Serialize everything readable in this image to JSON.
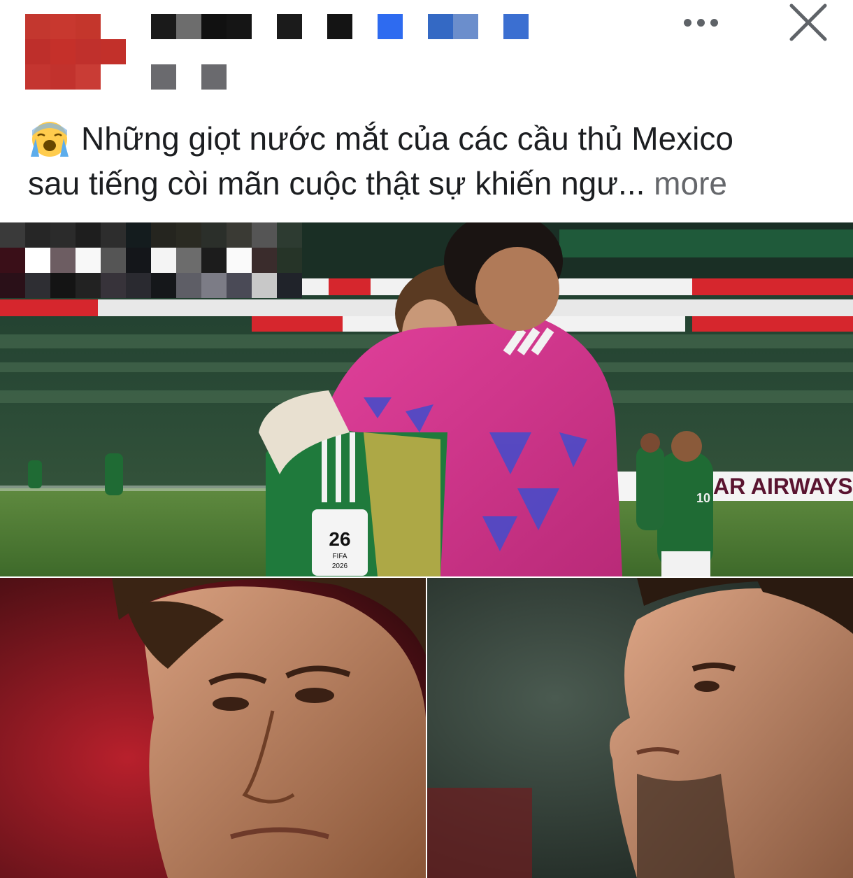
{
  "post": {
    "caption_line1": "Những giọt nước mắt của các cầu thủ Mexico",
    "caption_line2": "sau tiếng còi mãn cuộc thật sự khiến ngư...",
    "see_more": " more",
    "emoji_icon": "loudly-crying-face-icon"
  },
  "header": {
    "more_icon": "more-horizontal-icon",
    "close_icon": "close-icon"
  },
  "photos": {
    "top": {
      "board_text": "AR AIRWAYS",
      "number": "10",
      "year": "2026",
      "fifa": "FIFA"
    }
  },
  "colors": {
    "link_gray": "#65676b",
    "text": "#1c1e21",
    "blur_blue": "#2e6bf0"
  }
}
